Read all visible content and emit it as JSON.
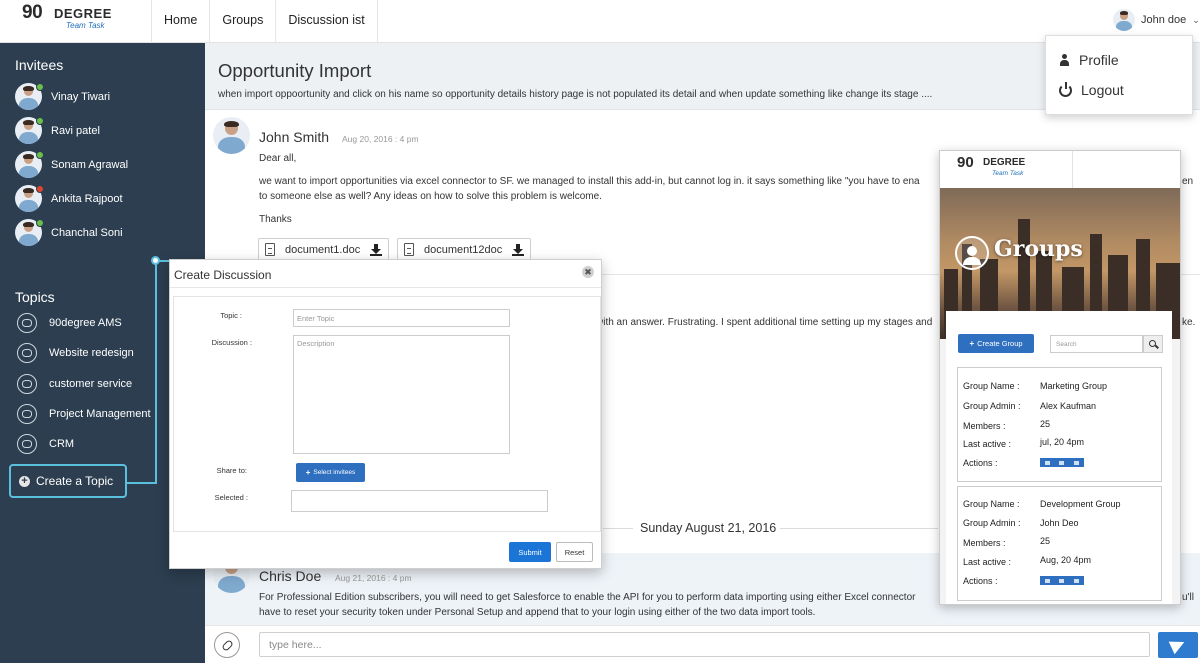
{
  "brand": {
    "number": "90",
    "word": "DEGREE",
    "tagline": "Team Task"
  },
  "nav": [
    {
      "label": "Home"
    },
    {
      "label": "Groups"
    },
    {
      "label": "Discussion ist"
    }
  ],
  "user": {
    "name": "John doe"
  },
  "profile_menu": {
    "profile_label": "Profile",
    "logout_label": "Logout"
  },
  "sidebar": {
    "invitees_title": "Invitees",
    "invitees": [
      {
        "name": "Vinay Tiwari",
        "status_color": "#6abf4b"
      },
      {
        "name": "Ravi patel",
        "status_color": "#6abf4b"
      },
      {
        "name": "Sonam Agrawal",
        "status_color": "#6abf4b"
      },
      {
        "name": "Ankita Rajpoot",
        "status_color": "#e0442f"
      },
      {
        "name": "Chanchal Soni",
        "status_color": "#6abf4b"
      }
    ],
    "topics_title": "Topics",
    "topics": [
      {
        "label": "90degree AMS"
      },
      {
        "label": "Website redesign"
      },
      {
        "label": "customer service"
      },
      {
        "label": "Project Management"
      },
      {
        "label": "CRM"
      }
    ],
    "create_topic_label": "Create a Topic"
  },
  "discussion": {
    "title": "Opportunity Import",
    "description": "when import oppoortunity and click on his name so opportunity details history page is not populated its detail and when update something like change its stage ....",
    "message1": {
      "author": "John Smith",
      "date": "Aug 20, 2016 : 4 pm",
      "greeting": "Dear all,",
      "line1": "we want to import opportunities via excel connector to SF. we managed to install this add-in, but cannot log in. it says something like \"you have to ena",
      "line1_tail": "en",
      "line2": "to someone else as well? Any ideas on how to solve this problem is welcome.",
      "thanks": "Thanks",
      "attachments": [
        {
          "name": "document1.doc"
        },
        {
          "name": "document12doc"
        }
      ]
    },
    "partial_line_a": "with an answer. Frustrating. I spent additional time setting up my stages and",
    "partial_line_a_tail": "ke.",
    "date_divider": "Sunday August 21, 2016",
    "message2": {
      "author": "Chris Doe",
      "date": "Aug 21, 2016 : 4 pm",
      "line1": "For Professional Edition subscribers, you will need to get Salesforce to enable the API for you to perform data importing using either Excel connector",
      "line1_tail": "u'll",
      "line2": "have to reset your security token under Personal Setup and append that to your login using either of the two data import tools."
    },
    "compose_placeholder": "type here..."
  },
  "modal": {
    "title": "Create Discussion",
    "close_glyph": "✖",
    "topic_label": "Topic :",
    "topic_placeholder": "Enter Topic",
    "discussion_label": "Discussion :",
    "discussion_placeholder": "Description",
    "share_label": "Share to:",
    "select_invitees_label": "Select invitees",
    "selected_label": "Selected :",
    "submit_label": "Submit",
    "reset_label": "Reset"
  },
  "groups_panel": {
    "brand_number": "90",
    "brand_word": "DEGREE",
    "brand_tagline": "Team Task",
    "hero_title": "Groups",
    "create_group_label": "Create Group",
    "search_placeholder": "Search",
    "field_labels": {
      "name": "Group Name :",
      "admin": "Group Admin :",
      "members": "Members :",
      "last_active": "Last active :",
      "actions": "Actions :"
    },
    "groups": [
      {
        "name": "Marketing Group",
        "admin": "Alex Kaufman",
        "members": "25",
        "last_active": "jul, 20 4pm"
      },
      {
        "name": "Development Group",
        "admin": "John Deo",
        "members": "25",
        "last_active": "Aug, 20 4pm"
      }
    ]
  },
  "colors": {
    "sidebar": "#2c3e50",
    "accent": "#2e6fbf",
    "highlight": "#5bc0de"
  }
}
